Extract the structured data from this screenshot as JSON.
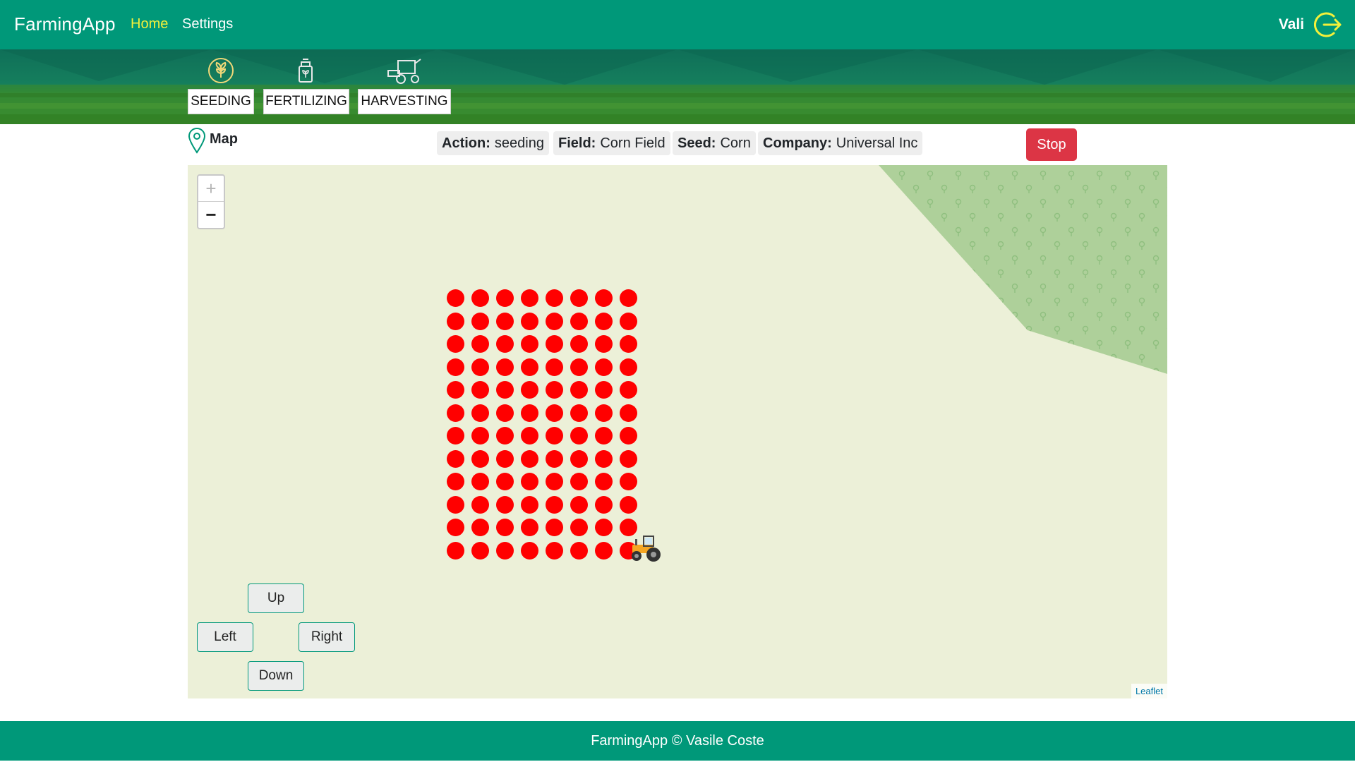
{
  "navbar": {
    "brand": "FarmingApp",
    "links": [
      {
        "label": "Home",
        "active": true
      },
      {
        "label": "Settings",
        "active": false
      }
    ],
    "user": "Vali",
    "logout_icon": "logout-icon",
    "colors": {
      "background": "#009879",
      "active_link": "#f3f03a"
    }
  },
  "actions": [
    {
      "label": "SEEDING",
      "icon": "seeding-icon"
    },
    {
      "label": "FERTILIZING",
      "icon": "fertilizing-icon"
    },
    {
      "label": "HARVESTING",
      "icon": "harvesting-icon"
    }
  ],
  "info": {
    "map_label": "Map",
    "chips": [
      {
        "key": "Action:",
        "value": "seeding"
      },
      {
        "key": "Field:",
        "value": "Corn Field"
      },
      {
        "key": "Seed:",
        "value": "Corn"
      },
      {
        "key": "Company:",
        "value": "Universal Inc"
      }
    ],
    "stop_label": "Stop",
    "stop_color": "#dc3545"
  },
  "map": {
    "zoom_in": "+",
    "zoom_out": "−",
    "seeded_grid": {
      "rows": 12,
      "cols": 8,
      "color": "#ff0000"
    },
    "vehicle_icon": "tractor-icon",
    "controls": {
      "up": "Up",
      "left": "Left",
      "right": "Right",
      "down": "Down"
    },
    "attribution": "Leaflet"
  },
  "footer": {
    "text": "FarmingApp © Vasile Coste"
  }
}
